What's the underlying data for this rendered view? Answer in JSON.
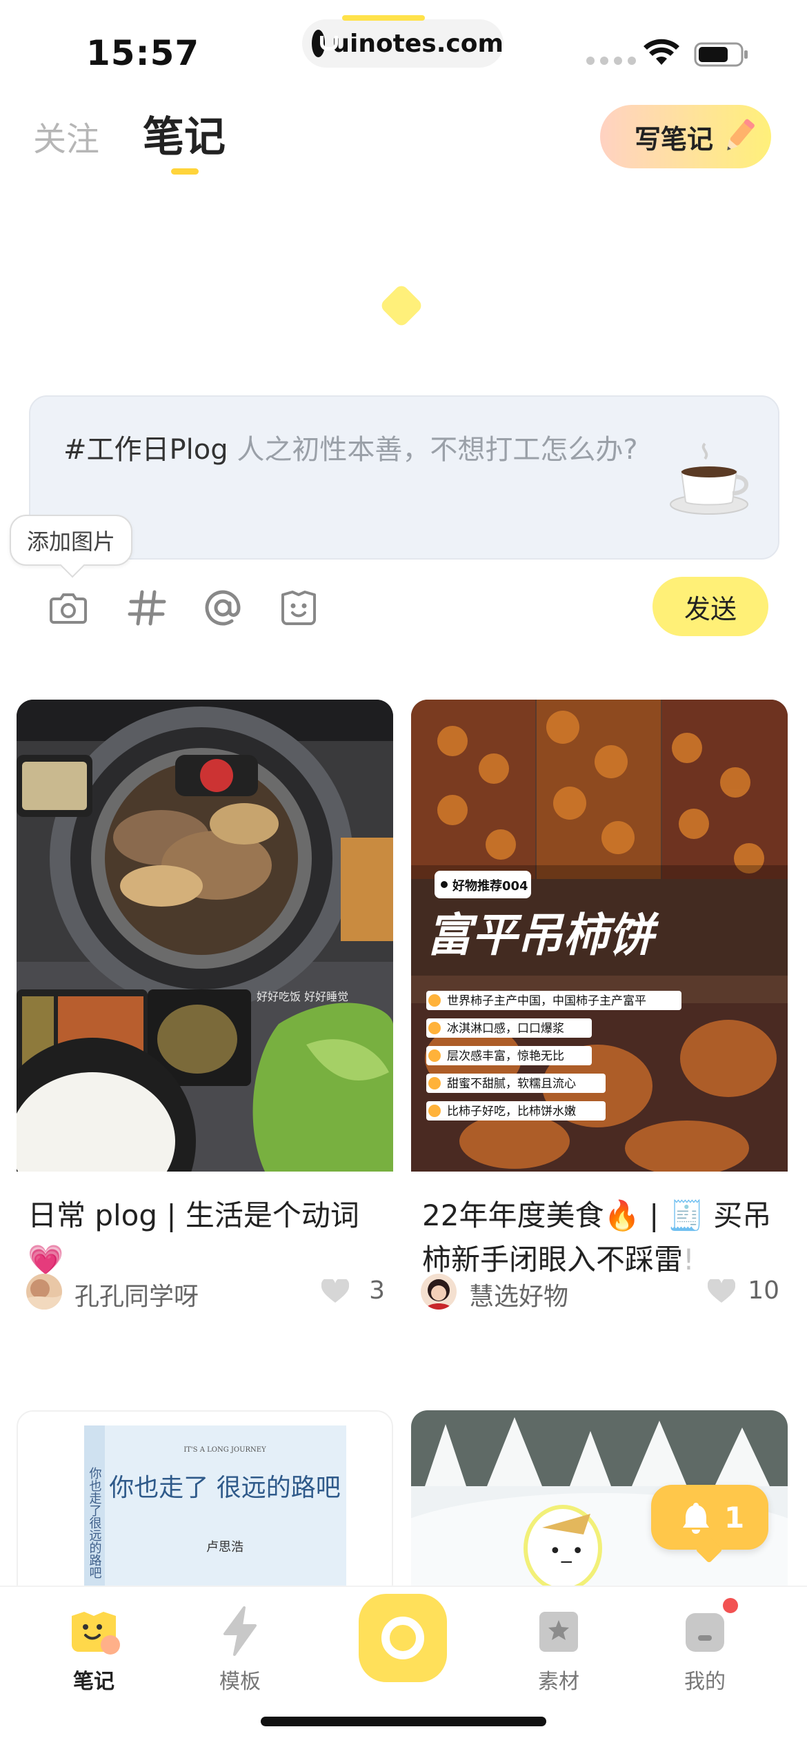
{
  "status_bar": {
    "time": "15:57",
    "url": "uinotes.com"
  },
  "header": {
    "tab_follow": "关注",
    "tab_notes": "笔记",
    "write_button": "写笔记"
  },
  "composer": {
    "tag": "#工作日Plog",
    "placeholder": " 人之初性本善，不想打工怎么办?",
    "tooltip": "添加图片",
    "tools": [
      "camera-icon",
      "hashtag-icon",
      "at-icon",
      "emoji-icon"
    ],
    "send_label": "发送"
  },
  "feed": [
    {
      "title": "日常 plog | 生活是个动词",
      "emoji": "💗",
      "author": "孔孔同学呀",
      "likes": "3",
      "image_overlay": "好好吃饭 好好睡觉"
    },
    {
      "title": "22年年度美食🔥 | 🧾 买吊柿新手闭眼入不踩雷",
      "title_tail": "!",
      "author": "慧选好物",
      "likes": "10",
      "image_badge": "好物推荐004",
      "image_heading": "富平吊柿饼",
      "image_bullets": [
        "世界柿子主产中国，中国柿子主产富平",
        "冰淇淋口感，口口爆浆",
        "层次感丰富，惊艳无比",
        "甜蜜不甜腻，软糯且流心",
        "比柿子好吃，比柿饼水嫩"
      ]
    },
    {
      "book_heading": "IT'S A LONG JOURNEY",
      "book_title": "你也走了 很远的路吧",
      "book_author": "卢思浩",
      "book_spine": "你也走了很远的路吧"
    }
  ],
  "notification": {
    "count": "1"
  },
  "bottom_nav": {
    "items": [
      {
        "label": "笔记",
        "active": true
      },
      {
        "label": "模板",
        "active": false
      },
      {
        "label": "素材",
        "active": false
      },
      {
        "label": "我的",
        "active": false
      }
    ]
  },
  "colors": {
    "accent_yellow": "#ffe05a",
    "send_button": "#fff077",
    "bell": "#ffc74a",
    "badge_red": "#f25252"
  }
}
